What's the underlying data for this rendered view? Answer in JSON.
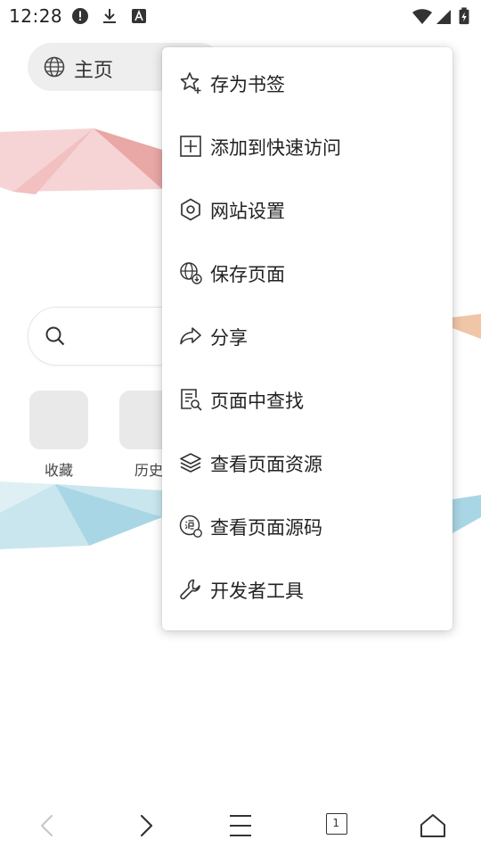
{
  "status_bar": {
    "time": "12:28"
  },
  "address_bar": {
    "title": "主页"
  },
  "shortcuts": [
    {
      "label": "收藏"
    },
    {
      "label": "历史"
    }
  ],
  "menu": {
    "items": [
      {
        "label": "存为书签",
        "icon": "star-plus-icon"
      },
      {
        "label": "添加到快速访问",
        "icon": "plus-square-icon"
      },
      {
        "label": "网站设置",
        "icon": "hex-settings-icon"
      },
      {
        "label": "保存页面",
        "icon": "globe-save-icon"
      },
      {
        "label": "分享",
        "icon": "share-arrow-icon"
      },
      {
        "label": "页面中查找",
        "icon": "find-in-page-icon"
      },
      {
        "label": "查看页面资源",
        "icon": "layers-icon"
      },
      {
        "label": "查看页面源码",
        "icon": "source-code-icon"
      },
      {
        "label": "开发者工具",
        "icon": "wrench-icon"
      }
    ]
  },
  "bottom_nav": {
    "tab_count": "1"
  }
}
